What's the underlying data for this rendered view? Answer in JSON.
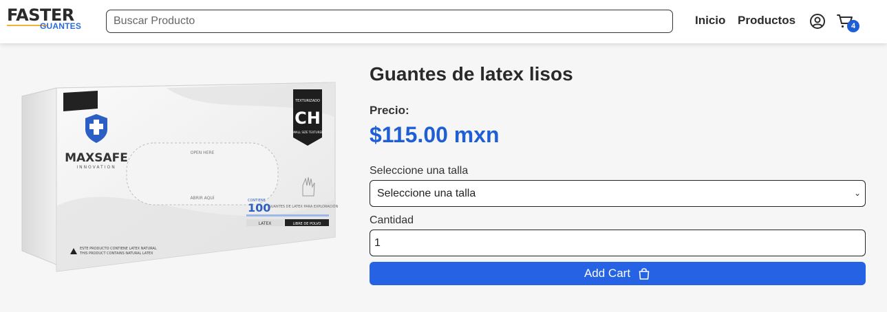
{
  "header": {
    "logo_top": "FASTER",
    "logo_bottom": "GUANTES",
    "search_placeholder": "Buscar Producto",
    "nav": [
      {
        "label": "Inicio"
      },
      {
        "label": "Productos"
      }
    ],
    "user_icon": "user-circle-icon",
    "cart_icon": "cart-icon",
    "cart_count": "4",
    "accent_color": "#1f5fd6"
  },
  "product": {
    "title": "Guantes de latex lisos",
    "price_label": "Precio:",
    "price": "$115.00 mxn",
    "size_label": "Seleccione una talla",
    "size_selected": "Seleccione una talla",
    "quantity_label": "Cantidad",
    "quantity_value": "1",
    "add_cart_label": "Add Cart",
    "add_cart_icon": "shopping-bag-icon",
    "button_color": "#2563e4"
  },
  "product_image": {
    "brand": "MAXSAFE",
    "brand_sub": "INNOVATION",
    "size_code": "CH",
    "size_tag_top": "TEXTURIZADO",
    "size_tag_bottom": "SMALL SIZE TEXTURED",
    "open_here": "OPEN HERE",
    "abrir_aqui": "ABRIR AQUÍ",
    "count_label": "CONTIENE",
    "count": "100",
    "count_desc": "GUANTES DE LATEX PARA EXPLORACIÓN",
    "latex_label": "LATEX",
    "powder_label": "LIBRE DE POLVO",
    "warning_es": "ESTE PRODUCTO CONTIENE LATEX NATURAL",
    "warning_en": "THIS PRODUCT CONTAINS NATURAL LATEX"
  }
}
